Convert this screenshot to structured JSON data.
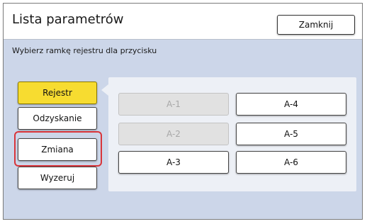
{
  "header": {
    "title": "Lista parametrów",
    "close_label": "Zamknij"
  },
  "subtitle": "Wybierz ramkę rejestru dla przycisku",
  "left_buttons": [
    {
      "label": "Rejestr",
      "state": "selected"
    },
    {
      "label": "Odzyskanie",
      "state": "normal"
    },
    {
      "label": "Zmiana",
      "state": "highlighted"
    },
    {
      "label": "Wyzeruj",
      "state": "normal"
    }
  ],
  "slots": [
    {
      "label": "A-1",
      "enabled": false
    },
    {
      "label": "A-4",
      "enabled": true
    },
    {
      "label": "A-2",
      "enabled": false
    },
    {
      "label": "A-5",
      "enabled": true
    },
    {
      "label": "A-3",
      "enabled": true
    },
    {
      "label": "A-6",
      "enabled": true
    }
  ],
  "colors": {
    "background": "#ccd6e9",
    "selected_button": "#f7dc30",
    "highlight_border": "#d9353a",
    "panel": "#edf0f6"
  }
}
